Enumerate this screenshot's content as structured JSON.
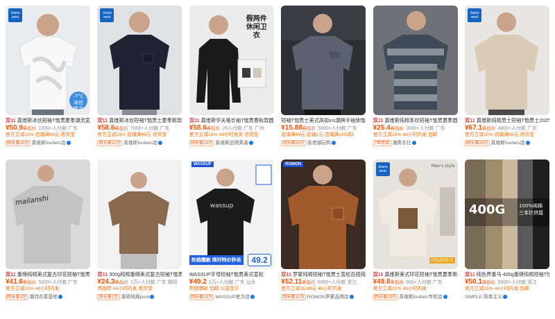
{
  "products": [
    {
      "badge": "Jeanswest 真维斯",
      "title": "真维斯冰丝短袖T恤男夏季潮流宽松",
      "price": "¥50.9",
      "price_tag": "券后价",
      "sales": "1000+人付款",
      "loc": "广东",
      "tags": "官方立减15%  店铺满99元  退货宝",
      "rep": "回头客20万",
      "shop": "真维斯foutlets店",
      "overlay": "-7°C 冰丝降温"
    },
    {
      "badge": "Jeanswest 真维斯",
      "title": "真维斯冰丝短袖T恤男士夏季新款",
      "price": "¥58.6",
      "price_tag": "券后价",
      "sales": "7000+人付款",
      "loc": "广东",
      "tags": "官方立减15%  店铺满99元  退货宝",
      "rep": "回头客20万",
      "shop": "真维斯foutlets店",
      "overlay": ""
    },
    {
      "badge": "",
      "title": "真维斯华夫格长袖T恤男春秋款圆领",
      "price": "¥58.6",
      "price_tag": "券后价",
      "sales": "26人付款",
      "loc": "广东 广州",
      "tags": "官方立减15%  48小时发货  退货宝",
      "rep": "回头客10万",
      "shop": "真维斯品牌男装",
      "overlay": "假两件 休闲卫衣"
    },
    {
      "badge": "",
      "title": "短袖T恤男士美式高街ins潮牌半袖体恤",
      "price": "¥15.88",
      "price_tag": "券后价",
      "sales": "5000+人付款",
      "loc": "广东",
      "tags": "店铺满99元  店铺1元  店铺满100减5",
      "rep": "回头客20万",
      "shop": "香港潮玩鸭",
      "overlay": ""
    },
    {
      "badge": "",
      "title": "真维斯纯棉条纹短袖T恤男夏季圆领条纹",
      "price": "¥25.4",
      "price_tag": "券后价",
      "sales": "3000+人付款",
      "loc": "广东",
      "tags": "官方立减15%  48小时内发  包邮",
      "rep": "7年老店",
      "shop": "潮男衣社",
      "overlay": ""
    },
    {
      "badge": "Jeanswest 真维斯",
      "title": "真维斯纯棉男士短袖T恤男士2025新款",
      "price": "¥67.1",
      "price_tag": "券后价",
      "sales": "4000+人付款",
      "loc": "广东",
      "tags": "官方立减15%  店铺满99元  退货宝",
      "rep": "回头客20万",
      "shop": "真维斯foutlets店",
      "overlay": ""
    },
    {
      "badge": "",
      "title": "重磅纯棉美式复古印花短袖T恤男宽松",
      "price": "¥41.6",
      "price_tag": "券后价",
      "sales": "5000+人付款",
      "loc": "广东",
      "tags": "官方立减15%  48小时内发",
      "rep": "回头客1万",
      "shop": "潮流衣着基地",
      "overlay": "mailanshi"
    },
    {
      "badge": "",
      "title": "300g纯棉重磅美式复古短袖T恤男宽松",
      "price": "¥24.3",
      "price_tag": "券后价",
      "sales": "1万+人付款",
      "loc": "广东 揭阳",
      "tags": "热销榜  48小时内发  退货宝",
      "rep": "回头客1万",
      "shop": "重磅纯棉pure",
      "overlay": ""
    },
    {
      "badge": "",
      "title": "WASSUP字母短袖T恤男美式宽松",
      "price": "¥49.2",
      "price_tag": "",
      "sales": "2万+人付款",
      "loc": "广东 汕头",
      "tags": "热销爆款  包邮  公益宝贝",
      "rep": "回头客10万",
      "shop": "WASSUP官方店",
      "overlay": "49.2",
      "promo": "热销爆款 限时特价秒杀"
    },
    {
      "badge": "ROMON 罗蒙",
      "title": "罗蒙纯棉短袖T恤男士宽松百搭纯色",
      "price": "¥52.11",
      "price_tag": "券后价",
      "sales": "6000+人付款",
      "loc": "浙江",
      "tags": "官方立减16.89元  48小时内发",
      "rep": "回头客10万",
      "shop": "ROMON罗蒙品牌店",
      "overlay": ""
    },
    {
      "badge": "Jeanswest 真维斯",
      "title": "真维斯美式印花短袖T恤男夏季新款",
      "price": "¥49.8",
      "price_tag": "券后价",
      "sales": "800+人付款",
      "loc": "广东",
      "tags": "官方立减15%  48小时内发",
      "rep": "回头客20万",
      "shop": "真维斯foutlets专柜店",
      "overlay": "COLOUR·5"
    },
    {
      "badge": "",
      "title": "纯色界重马 400g重磅纯棉短袖T恤",
      "price": "¥50.1",
      "price_tag": "券后价",
      "sales": "5000+人付款",
      "loc": "浙江",
      "tags": "官方立减15%  48小时内发  包邮",
      "rep": "",
      "shop": "SIMPLE 简单主义",
      "overlay": "400G"
    }
  ],
  "overlay_extra": {
    "p12_sub": "100%纯棉 三本针拼接",
    "p5_men": "Men's style"
  },
  "double11": "双11",
  "colors": {
    "price": "#ff4d00",
    "double11": "#e4393c",
    "brand_blue": "#1d4fd6",
    "tag_orange": "#ff6a00"
  }
}
